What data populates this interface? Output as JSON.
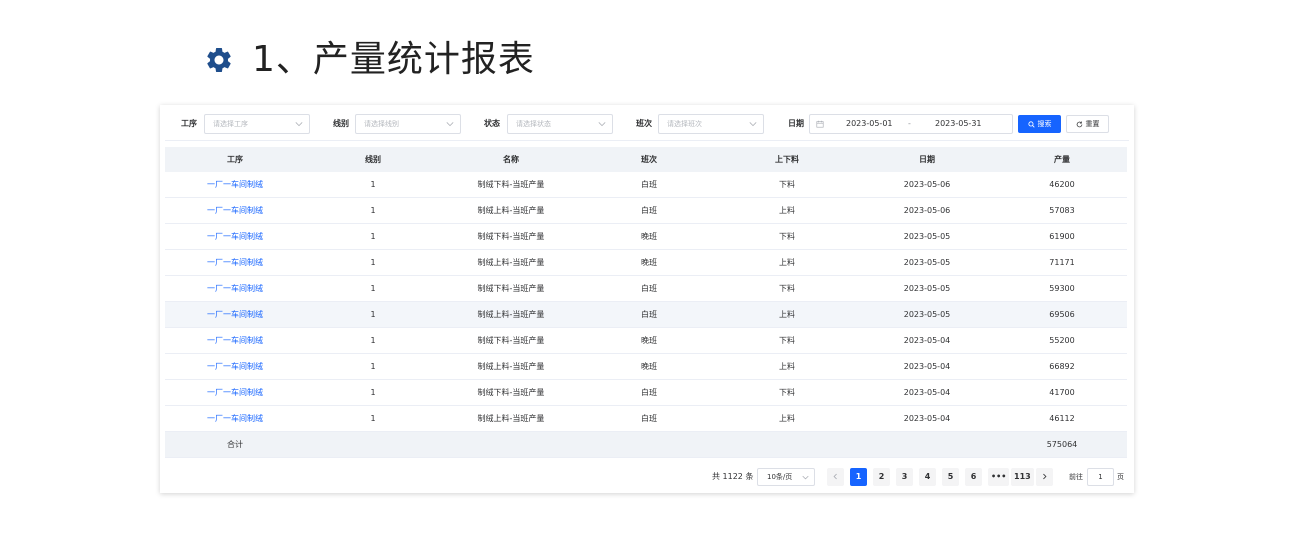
{
  "heading": {
    "icon": "gear-icon",
    "title": "1、产量统计报表",
    "icon_color": "#1f4e8c"
  },
  "filters": {
    "process": {
      "label": "工序",
      "placeholder": "请选择工序"
    },
    "line": {
      "label": "线别",
      "placeholder": "请选择线别"
    },
    "status": {
      "label": "状态",
      "placeholder": "请选择状态"
    },
    "shift": {
      "label": "班次",
      "placeholder": "请选择班次"
    },
    "date": {
      "label": "日期",
      "start": "2023-05-01",
      "separator": "-",
      "end": "2023-05-31"
    },
    "search_label": "搜索",
    "reset_label": "重置"
  },
  "table": {
    "columns": [
      "工序",
      "线别",
      "名称",
      "班次",
      "上下料",
      "日期",
      "产量"
    ],
    "rows": [
      [
        "一厂一车间制绒",
        "1",
        "制绒下料-当班产量",
        "白班",
        "下料",
        "2023-05-06",
        "46200"
      ],
      [
        "一厂一车间制绒",
        "1",
        "制绒上料-当班产量",
        "白班",
        "上料",
        "2023-05-06",
        "57083"
      ],
      [
        "一厂一车间制绒",
        "1",
        "制绒下料-当班产量",
        "晚班",
        "下料",
        "2023-05-05",
        "61900"
      ],
      [
        "一厂一车间制绒",
        "1",
        "制绒上料-当班产量",
        "晚班",
        "上料",
        "2023-05-05",
        "71171"
      ],
      [
        "一厂一车间制绒",
        "1",
        "制绒下料-当班产量",
        "白班",
        "下料",
        "2023-05-05",
        "59300"
      ],
      [
        "一厂一车间制绒",
        "1",
        "制绒上料-当班产量",
        "白班",
        "上料",
        "2023-05-05",
        "69506"
      ],
      [
        "一厂一车间制绒",
        "1",
        "制绒下料-当班产量",
        "晚班",
        "下料",
        "2023-05-04",
        "55200"
      ],
      [
        "一厂一车间制绒",
        "1",
        "制绒上料-当班产量",
        "晚班",
        "上料",
        "2023-05-04",
        "66892"
      ],
      [
        "一厂一车间制绒",
        "1",
        "制绒下料-当班产量",
        "白班",
        "下料",
        "2023-05-04",
        "41700"
      ],
      [
        "一厂一车间制绒",
        "1",
        "制绒上料-当班产量",
        "白班",
        "上料",
        "2023-05-04",
        "46112"
      ]
    ],
    "highlighted_row": 5,
    "summary": {
      "label": "合计",
      "total": "575064"
    }
  },
  "pagination": {
    "total_text": "共 1122 条",
    "page_size": "10条/页",
    "pages": [
      "1",
      "2",
      "3",
      "4",
      "5",
      "6",
      "•••",
      "113"
    ],
    "current_page": "1",
    "goto_label": "前往",
    "goto_value": "1",
    "goto_suffix": "页"
  },
  "colors": {
    "primary": "#1664ff",
    "link": "#1664ff",
    "header_bg": "#f0f3f7"
  }
}
